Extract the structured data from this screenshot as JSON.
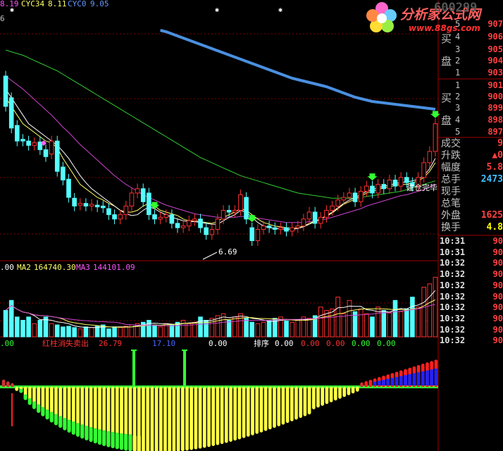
{
  "top_indicator": {
    "v1": "8.19",
    "cyc34_label": "CYC34",
    "cyc34_value": "8.11",
    "cyc0_label": "CYC0",
    "cyc0_value": "9.05",
    "corner_digit": "6"
  },
  "volume_indicator": {
    "ma1_value": ".00",
    "ma2_label": "MA2",
    "ma2_value": "164740.30",
    "ma3_label": "MA3",
    "ma3_value": "144101.09"
  },
  "bottom_indicator": {
    "v0": ".00",
    "signal_label": "红柱消失卖出",
    "signal_value": "26.79",
    "value_blue": "17.10",
    "value_white": "0.00",
    "sort_label": "排序",
    "sort_value": "0.00",
    "red_values": [
      "0.00",
      "0.00"
    ],
    "green_values": [
      "0.00",
      "0.00"
    ]
  },
  "annotations": {
    "low_label": "6.69",
    "build_label": "建仓完毕"
  },
  "logo": {
    "brand": "分析家公式网",
    "url": "www.88gs.com",
    "ghost_number": "600299"
  },
  "order_book": {
    "sell_label": [
      "买",
      "盘"
    ],
    "buy_label": [
      "买",
      "盘"
    ],
    "sell": [
      {
        "level": "5",
        "price": "907"
      },
      {
        "level": "4",
        "price": "906"
      },
      {
        "level": "3",
        "price": "905"
      },
      {
        "level": "2",
        "price": "904"
      },
      {
        "level": "1",
        "price": "903"
      }
    ],
    "buy": [
      {
        "level": "1",
        "price": "901"
      },
      {
        "level": "2",
        "price": "900"
      },
      {
        "level": "3",
        "price": "899"
      },
      {
        "level": "4",
        "price": "898"
      },
      {
        "level": "5",
        "price": "897"
      }
    ]
  },
  "quote": [
    {
      "label": "成交",
      "value": "9",
      "color": "#ff4040"
    },
    {
      "label": "升跌",
      "value": "▲0",
      "color": "#ff4040"
    },
    {
      "label": "幅度",
      "value": "5.8",
      "color": "#ff4040"
    },
    {
      "label": "总手",
      "value": "2473",
      "color": "#40c0ff"
    },
    {
      "label": "现手",
      "value": "",
      "color": "#ffff00"
    },
    {
      "label": "总笔",
      "value": "",
      "color": "#ffff00"
    },
    {
      "label": "外盘",
      "value": "1625",
      "color": "#ff4040"
    },
    {
      "label": "换手",
      "value": "4.8",
      "color": "#ffff00"
    }
  ],
  "ticks": [
    {
      "time": "10:31",
      "price": "90"
    },
    {
      "time": "10:31",
      "price": "90"
    },
    {
      "time": "10:32",
      "price": "90"
    },
    {
      "time": "10:32",
      "price": "90"
    },
    {
      "time": "10:32",
      "price": "90"
    },
    {
      "time": "10:32",
      "price": "90"
    },
    {
      "time": "10:32",
      "price": "90"
    },
    {
      "time": "10:32",
      "price": "90"
    },
    {
      "time": "10:32",
      "price": "90"
    },
    {
      "time": "10:32",
      "price": "90"
    }
  ],
  "colors": {
    "up": "#ff3030",
    "down": "#54ffff",
    "ma_white": "#ffffff",
    "ma_yellow": "#ffff66",
    "ma_purple": "#cc44cc",
    "ma_green": "#33cc33",
    "cyc_blue": "#4a90e0",
    "osc_yellow": "#ffff44",
    "osc_green": "#33ff33",
    "osc_red": "#ff2020",
    "osc_blue": "#2222ff"
  },
  "chart_data": {
    "type": "candlestick",
    "candles": [
      {
        "o": 8.55,
        "c": 8.2
      },
      {
        "o": 8.3,
        "c": 7.95
      },
      {
        "o": 7.98,
        "c": 7.8
      },
      {
        "o": 7.82,
        "c": 7.8
      },
      {
        "o": 7.8,
        "c": 7.75
      },
      {
        "o": 7.75,
        "c": 7.78
      },
      {
        "o": 7.79,
        "c": 7.7
      },
      {
        "o": 7.7,
        "c": 7.62
      },
      {
        "o": 7.65,
        "c": 7.8
      },
      {
        "o": 7.8,
        "c": 7.45
      },
      {
        "o": 7.5,
        "c": 7.35
      },
      {
        "o": 7.36,
        "c": 7.15
      },
      {
        "o": 7.14,
        "c": 7.05
      },
      {
        "o": 7.06,
        "c": 7.08
      },
      {
        "o": 7.08,
        "c": 7.05
      },
      {
        "o": 7.05,
        "c": 7.07
      },
      {
        "o": 7.06,
        "c": 7.04
      },
      {
        "o": 7.05,
        "c": 7.03
      },
      {
        "o": 7.02,
        "c": 6.95
      },
      {
        "o": 6.95,
        "c": 6.9
      },
      {
        "o": 6.9,
        "c": 6.95
      },
      {
        "o": 6.95,
        "c": 7.05
      },
      {
        "o": 7.05,
        "c": 7.2
      },
      {
        "o": 7.2,
        "c": 7.25
      },
      {
        "o": 7.25,
        "c": 7.1
      },
      {
        "o": 7.2,
        "c": 6.95
      },
      {
        "o": 6.95,
        "c": 6.9
      },
      {
        "o": 6.9,
        "c": 6.92
      },
      {
        "o": 6.92,
        "c": 6.95
      },
      {
        "o": 6.95,
        "c": 6.85
      },
      {
        "o": 6.85,
        "c": 6.8
      },
      {
        "o": 6.8,
        "c": 6.82
      },
      {
        "o": 6.82,
        "c": 6.88
      },
      {
        "o": 6.88,
        "c": 6.9
      },
      {
        "o": 6.9,
        "c": 6.8
      },
      {
        "o": 6.8,
        "c": 6.72
      },
      {
        "o": 6.72,
        "c": 6.78
      },
      {
        "o": 6.78,
        "c": 6.9
      },
      {
        "o": 6.9,
        "c": 7.0
      },
      {
        "o": 7.0,
        "c": 6.98
      },
      {
        "o": 6.98,
        "c": 7.0
      },
      {
        "o": 7.0,
        "c": 7.18
      },
      {
        "o": 7.15,
        "c": 6.9
      },
      {
        "o": 6.8,
        "c": 6.65
      },
      {
        "o": 6.65,
        "c": 6.78
      },
      {
        "o": 6.78,
        "c": 6.82
      },
      {
        "o": 6.82,
        "c": 6.8
      },
      {
        "o": 6.8,
        "c": 6.78
      },
      {
        "o": 6.78,
        "c": 6.8
      },
      {
        "o": 6.8,
        "c": 6.76
      },
      {
        "o": 6.76,
        "c": 6.8
      },
      {
        "o": 6.8,
        "c": 6.82
      },
      {
        "o": 6.82,
        "c": 6.9
      },
      {
        "o": 6.9,
        "c": 6.98
      },
      {
        "o": 6.98,
        "c": 6.85
      },
      {
        "o": 6.85,
        "c": 6.92
      },
      {
        "o": 6.92,
        "c": 7.0
      },
      {
        "o": 7.0,
        "c": 7.05
      },
      {
        "o": 7.05,
        "c": 7.12
      },
      {
        "o": 7.12,
        "c": 7.15
      },
      {
        "o": 7.15,
        "c": 7.2
      },
      {
        "o": 7.2,
        "c": 7.1
      },
      {
        "o": 7.1,
        "c": 7.22
      },
      {
        "o": 7.22,
        "c": 7.28
      },
      {
        "o": 7.28,
        "c": 7.2
      },
      {
        "o": 7.2,
        "c": 7.3
      },
      {
        "o": 7.3,
        "c": 7.25
      },
      {
        "o": 7.25,
        "c": 7.35
      },
      {
        "o": 7.35,
        "c": 7.28
      },
      {
        "o": 7.28,
        "c": 7.38
      },
      {
        "o": 7.38,
        "c": 7.32
      },
      {
        "o": 7.32,
        "c": 7.28
      },
      {
        "o": 7.28,
        "c": 7.38
      },
      {
        "o": 7.38,
        "c": 7.55
      },
      {
        "o": 7.55,
        "c": 7.68
      },
      {
        "o": 7.68,
        "c": 8.0
      }
    ],
    "ma_short": [
      8.3,
      8.2,
      8.1,
      8.0,
      7.95,
      7.9,
      7.85,
      7.8,
      7.78,
      7.72,
      7.6,
      7.5,
      7.4,
      7.3,
      7.25,
      7.2,
      7.15,
      7.12,
      7.08,
      7.05,
      7.0,
      6.98,
      6.98,
      7.0,
      7.05,
      7.08,
      7.05,
      7.0,
      6.98,
      6.96,
      6.94,
      6.9,
      6.88,
      6.88,
      6.87,
      6.86,
      6.85,
      6.87,
      6.92,
      6.95,
      6.98,
      7.02,
      7.0,
      6.95,
      6.9,
      6.86,
      6.84,
      6.82,
      6.81,
      6.8,
      6.79,
      6.8,
      6.82,
      6.85,
      6.88,
      6.9,
      6.93,
      6.97,
      7.02,
      7.07,
      7.1,
      7.13,
      7.16,
      7.2,
      7.22,
      7.24,
      7.26,
      7.27,
      7.29,
      7.3,
      7.3,
      7.32,
      7.34,
      7.38,
      7.45,
      7.55
    ],
    "ma_mid": [
      8.55,
      8.5,
      8.45,
      8.4,
      8.34,
      8.28,
      8.22,
      8.16,
      8.1,
      8.03,
      7.96,
      7.9,
      7.83,
      7.76,
      7.7,
      7.64,
      7.58,
      7.52,
      7.46,
      7.4,
      7.35,
      7.3,
      7.26,
      7.22,
      7.18,
      7.15,
      7.12,
      7.09,
      7.06,
      7.04,
      7.02,
      7.0,
      6.98,
      6.96,
      6.95,
      6.94,
      6.93,
      6.92,
      6.92,
      6.92,
      6.92,
      6.93,
      6.93,
      6.92,
      6.91,
      6.9,
      6.89,
      6.88,
      6.87,
      6.86,
      6.86,
      6.86,
      6.86,
      6.87,
      6.88,
      6.89,
      6.9,
      6.92,
      6.94,
      6.96,
      6.98,
      7.0,
      7.02,
      7.05,
      7.07,
      7.09,
      7.11,
      7.13,
      7.15,
      7.17,
      7.18,
      7.2,
      7.22,
      7.24,
      7.27,
      7.3
    ],
    "ma_long": [
      8.85,
      8.83,
      8.81,
      8.79,
      8.76,
      8.73,
      8.7,
      8.67,
      8.64,
      8.61,
      8.57,
      8.53,
      8.49,
      8.45,
      8.41,
      8.37,
      8.33,
      8.29,
      8.25,
      8.21,
      8.17,
      8.13,
      8.09,
      8.05,
      8.01,
      7.97,
      7.93,
      7.89,
      7.85,
      7.81,
      7.77,
      7.73,
      7.69,
      7.65,
      7.61,
      7.58,
      7.55,
      7.52,
      7.49,
      7.46,
      7.43,
      7.4,
      7.38,
      7.36,
      7.34,
      7.32,
      7.3,
      7.28,
      7.26,
      7.24,
      7.22,
      7.2,
      7.19,
      7.18,
      7.17,
      7.16,
      7.15,
      7.14,
      7.14,
      7.14,
      7.14,
      7.14,
      7.15,
      7.16,
      7.17,
      7.18,
      7.19,
      7.2,
      7.21,
      7.22,
      7.24,
      7.26,
      7.28,
      7.3,
      7.32,
      7.34
    ],
    "ma_white": [
      8.4,
      8.3,
      8.2,
      8.1,
      8.0,
      7.95,
      7.9,
      7.85,
      7.8,
      7.75,
      7.68,
      7.6,
      7.5,
      7.4,
      7.32,
      7.25,
      7.2,
      7.15,
      7.1,
      7.05,
      7.0,
      6.96,
      6.94,
      6.95,
      7.0,
      7.04,
      7.02,
      6.98,
      6.95,
      6.92,
      6.9,
      6.88,
      6.87,
      6.87,
      6.86,
      6.85,
      6.84,
      6.84,
      6.88,
      6.92,
      6.95,
      7.0,
      6.98,
      6.92,
      6.86,
      6.82,
      6.8,
      6.79,
      6.79,
      6.78,
      6.78,
      6.79,
      6.81,
      6.84,
      6.87,
      6.9,
      6.94,
      6.98,
      7.03,
      7.08,
      7.12,
      7.15,
      7.18,
      7.22,
      7.24,
      7.26,
      7.28,
      7.29,
      7.31,
      7.32,
      7.33,
      7.34,
      7.36,
      7.4,
      7.48,
      7.6
    ],
    "cyc0": [
      null,
      null,
      null,
      null,
      null,
      null,
      null,
      null,
      null,
      null,
      null,
      null,
      null,
      null,
      null,
      null,
      null,
      null,
      null,
      null,
      null,
      null,
      null,
      null,
      null,
      null,
      null,
      9.05,
      9.03,
      9.0,
      8.97,
      8.94,
      8.91,
      8.88,
      8.85,
      8.82,
      8.79,
      8.76,
      8.73,
      8.7,
      8.67,
      8.64,
      8.61,
      8.58,
      8.55,
      8.52,
      8.49,
      8.46,
      8.43,
      8.4,
      8.37,
      8.35,
      8.33,
      8.31,
      8.29,
      8.27,
      8.25,
      8.22,
      8.19,
      8.16,
      8.13,
      8.1,
      8.08,
      8.06,
      8.04,
      8.03,
      8.02,
      8.01,
      8.0,
      7.99,
      7.98,
      7.97,
      7.96,
      7.95,
      7.94,
      7.93
    ],
    "volume": [
      40,
      55,
      30,
      25,
      30,
      20,
      25,
      30,
      20,
      18,
      15,
      16,
      14,
      12,
      15,
      14,
      16,
      18,
      12,
      15,
      14,
      16,
      18,
      20,
      22,
      25,
      18,
      15,
      20,
      18,
      22,
      25,
      20,
      22,
      30,
      25,
      28,
      32,
      35,
      25,
      30,
      35,
      28,
      22,
      20,
      22,
      25,
      28,
      30,
      24,
      22,
      26,
      30,
      28,
      32,
      45,
      40,
      42,
      60,
      35,
      55,
      38,
      42,
      35,
      30,
      45,
      40,
      36,
      55,
      38,
      42,
      60,
      45,
      75,
      80,
      90
    ],
    "price_ylim": [
      6.5,
      9.2
    ],
    "volume_ylim": [
      0,
      100
    ],
    "ma_labels": [
      "MA2",
      "MA3"
    ]
  }
}
